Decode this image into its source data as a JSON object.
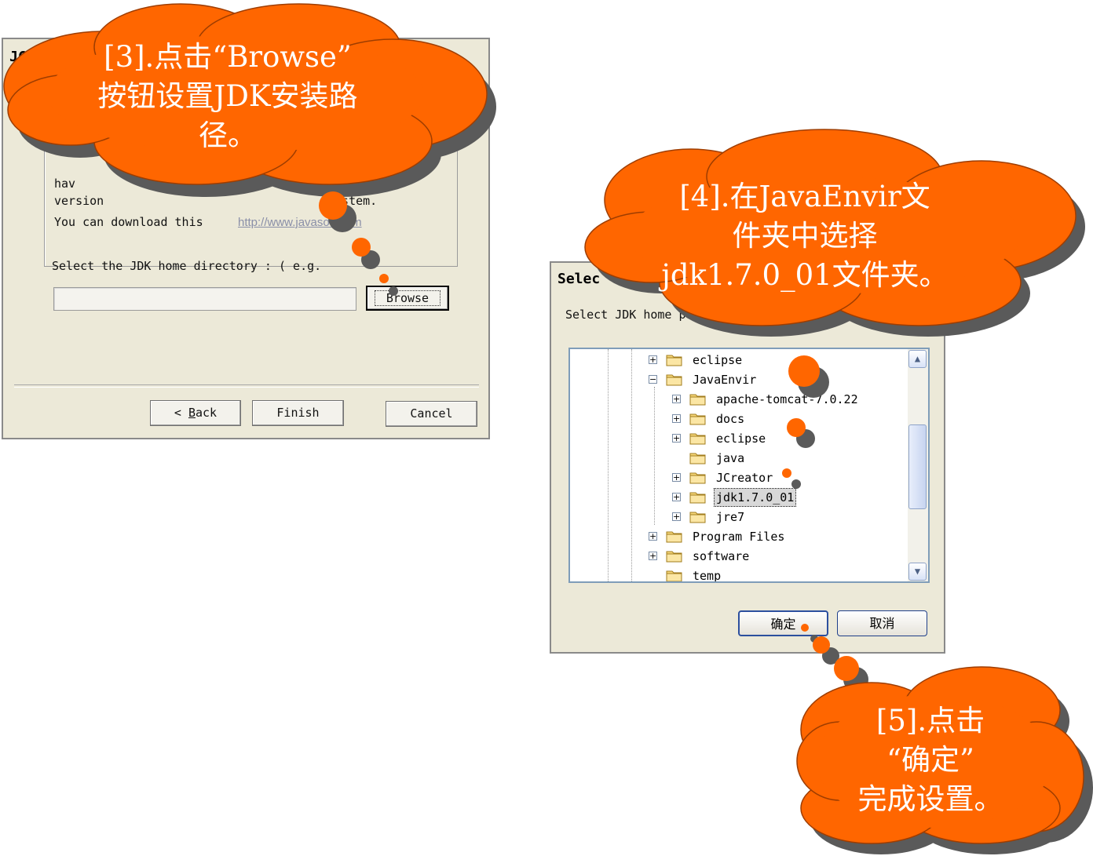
{
  "colors": {
    "cloud_fill": "#ff6600",
    "cloud_shadow": "#5a5a5a",
    "dialog_bg": "#ece9d8",
    "link": "#8a8fa8"
  },
  "dialog1": {
    "title": "JCre",
    "info_line1": "hav",
    "info_line2_a": "version",
    "info_line2_b": "system.",
    "info_line3": "You can download this",
    "info_link": "http://www.javasoft.com",
    "select_label": "Select the JDK home directory : (  e.g.",
    "path_value": "",
    "browse_label": "Browse",
    "back_label_prefix": "< ",
    "back_label_mnemonic": "B",
    "back_label_rest": "ack",
    "finish_label": "Finish",
    "cancel_label": "Cancel"
  },
  "dialog2": {
    "title": "Selec",
    "label": "Select JDK home path (e.g C:\\)",
    "tree": [
      {
        "label": "eclipse",
        "level": 0,
        "expander": "plus"
      },
      {
        "label": "JavaEnvir",
        "level": 0,
        "expander": "minus"
      },
      {
        "label": "apache-tomcat-7.0.22",
        "level": 1,
        "expander": "plus"
      },
      {
        "label": "docs",
        "level": 1,
        "expander": "plus"
      },
      {
        "label": "eclipse",
        "level": 1,
        "expander": "plus"
      },
      {
        "label": "java",
        "level": 1,
        "expander": "none"
      },
      {
        "label": "JCreator",
        "level": 1,
        "expander": "plus"
      },
      {
        "label": "jdk1.7.0_01",
        "level": 1,
        "expander": "plus",
        "selected": true
      },
      {
        "label": "jre7",
        "level": 1,
        "expander": "plus"
      },
      {
        "label": "Program Files",
        "level": 0,
        "expander": "plus"
      },
      {
        "label": "software",
        "level": 0,
        "expander": "plus"
      },
      {
        "label": "temp",
        "level": 0,
        "expander": "none"
      }
    ],
    "ok_label": "确定",
    "cancel_label": "取消"
  },
  "callouts": {
    "c3": {
      "line1": "[3].点击“Browse”",
      "line2": "按钮设置JDK安装路",
      "line3": "径。"
    },
    "c4": {
      "line1": "[4].在JavaEnvir文",
      "line2": "件夹中选择",
      "line3": "jdk1.7.0_01文件夹。"
    },
    "c5": {
      "line1": "[5].点击",
      "line2": "“确定”",
      "line3": "完成设置。"
    }
  }
}
